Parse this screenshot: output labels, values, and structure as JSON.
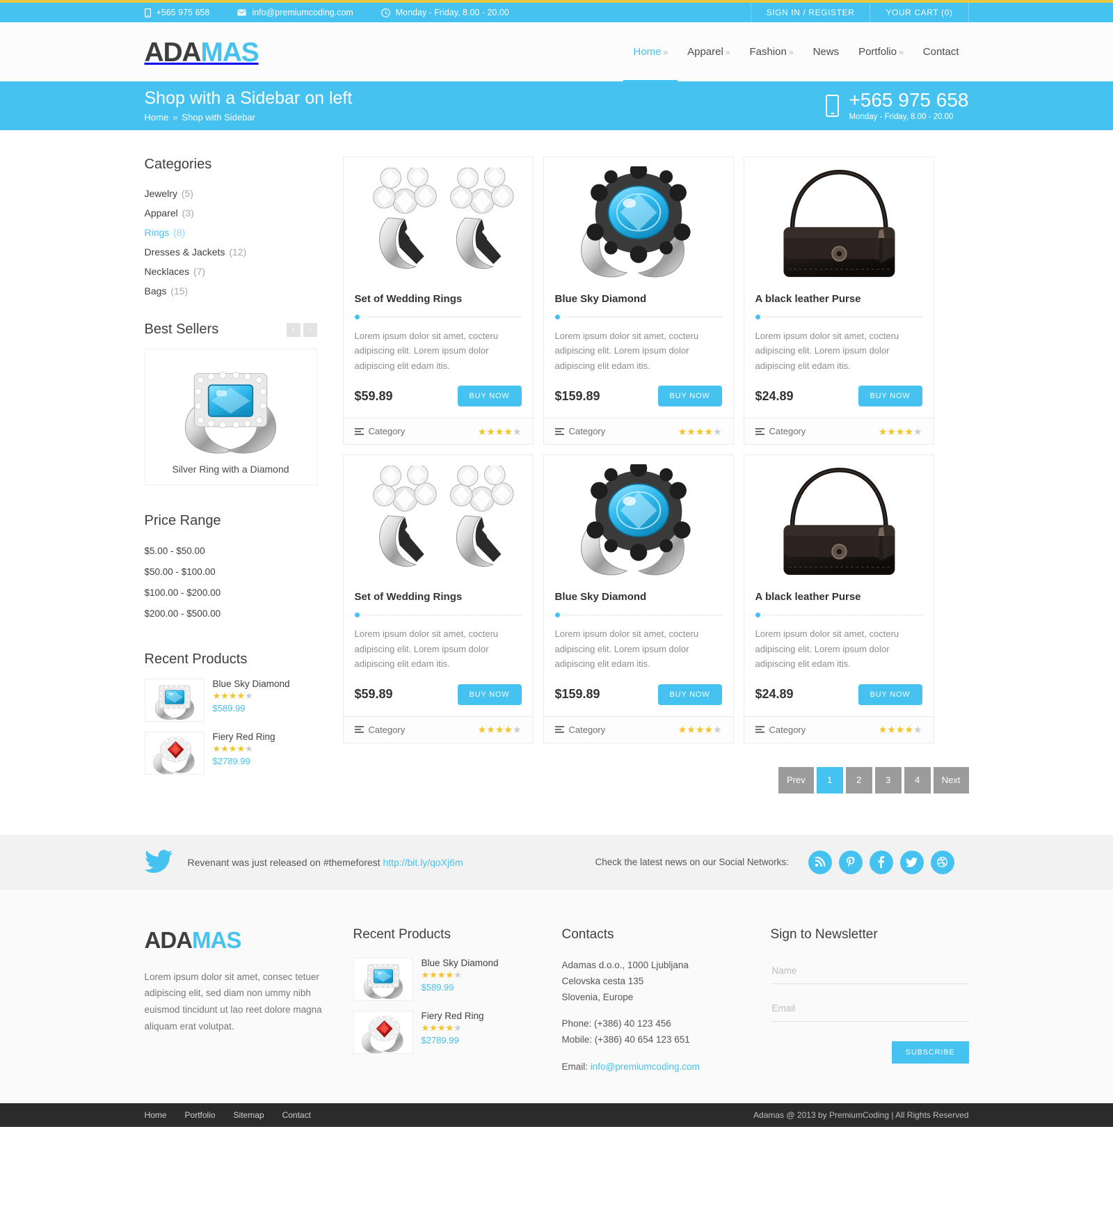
{
  "topbar": {
    "phone": "+565 975 658",
    "email": "info@premiumcoding.com",
    "hours": "Monday - Friday, 8.00 - 20.00",
    "signin": "SIGN IN / REGISTER",
    "cart": "YOUR CART (0)"
  },
  "header": {
    "logo_part1": "ADA",
    "logo_part2": "MAS",
    "nav": [
      {
        "label": "Home",
        "caret": "»",
        "active": true
      },
      {
        "label": "Apparel",
        "caret": "»",
        "active": false
      },
      {
        "label": "Fashion",
        "caret": "»",
        "active": false
      },
      {
        "label": "News",
        "caret": "",
        "active": false
      },
      {
        "label": "Portfolio",
        "caret": "»",
        "active": false
      },
      {
        "label": "Contact",
        "caret": "",
        "active": false
      }
    ]
  },
  "titlebar": {
    "title": "Shop with a Sidebar on left",
    "crumb_home": "Home",
    "crumb_sep": "»",
    "crumb_current": "Shop with Sidebar",
    "phone": "+565 975 658",
    "hours": "Monday - Friday, 8.00 - 20.00"
  },
  "sidebar": {
    "categories_heading": "Categories",
    "categories": [
      {
        "label": "Jewelry",
        "count": "(5)",
        "selected": false
      },
      {
        "label": "Apparel",
        "count": "(3)",
        "selected": false
      },
      {
        "label": "Rings",
        "count": "(8)",
        "selected": true
      },
      {
        "label": "Dresses & Jackets",
        "count": "(12)",
        "selected": false
      },
      {
        "label": "Necklaces",
        "count": "(7)",
        "selected": false
      },
      {
        "label": "Bags",
        "count": "(15)",
        "selected": false
      }
    ],
    "bestsellers_heading": "Best Sellers",
    "bestseller_prev": "‹",
    "bestseller_next": "›",
    "bestseller_caption": "Silver Ring with a Diamond",
    "pricerange_heading": "Price Range",
    "price_ranges": [
      "$5.00 - $50.00",
      "$50.00 - $100.00",
      "$100.00 - $200.00",
      "$200.00 - $500.00"
    ],
    "recent_heading": "Recent Products",
    "recent": [
      {
        "name": "Blue Sky Diamond",
        "rating": 4,
        "price": "$589.99"
      },
      {
        "name": "Fiery Red Ring",
        "rating": 4,
        "price": "$2789.99"
      }
    ]
  },
  "products": [
    {
      "title": "Set of Wedding Rings",
      "desc": "Lorem ipsum dolor sit amet, cocteru adipiscing elit. Lorem ipsum dolor adipiscing elit edam itis.",
      "price": "$59.89",
      "buy": "BUY NOW",
      "category": "Category",
      "rating": 4,
      "image": "wedding-rings"
    },
    {
      "title": "Blue Sky Diamond",
      "desc": "Lorem ipsum dolor sit amet, cocteru adipiscing elit. Lorem ipsum dolor adipiscing elit edam itis.",
      "price": "$159.89",
      "buy": "BUY NOW",
      "category": "Category",
      "rating": 4,
      "image": "blue-ring"
    },
    {
      "title": "A black leather Purse",
      "desc": "Lorem ipsum dolor sit amet, cocteru adipiscing elit. Lorem ipsum dolor adipiscing elit edam itis.",
      "price": "$24.89",
      "buy": "BUY NOW",
      "category": "Category",
      "rating": 4,
      "image": "purse"
    },
    {
      "title": "Set of Wedding Rings",
      "desc": "Lorem ipsum dolor sit amet, cocteru adipiscing elit. Lorem ipsum dolor adipiscing elit edam itis.",
      "price": "$59.89",
      "buy": "BUY NOW",
      "category": "Category",
      "rating": 4,
      "image": "wedding-rings"
    },
    {
      "title": "Blue Sky Diamond",
      "desc": "Lorem ipsum dolor sit amet, cocteru adipiscing elit. Lorem ipsum dolor adipiscing elit edam itis.",
      "price": "$159.89",
      "buy": "BUY NOW",
      "category": "Category",
      "rating": 4,
      "image": "blue-ring"
    },
    {
      "title": "A black leather Purse",
      "desc": "Lorem ipsum dolor sit amet, cocteru adipiscing elit. Lorem ipsum dolor adipiscing elit edam itis.",
      "price": "$24.89",
      "buy": "BUY NOW",
      "category": "Category",
      "rating": 4,
      "image": "purse"
    }
  ],
  "pagination": {
    "prev": "Prev",
    "pages": [
      "1",
      "2",
      "3",
      "4"
    ],
    "current": "1",
    "next": "Next"
  },
  "twitterbar": {
    "tweet_prefix": "Revenant was just released on #themeforest ",
    "tweet_link": "http://bit.ly/qoXj6m",
    "social_label": "Check the latest news on our Social Networks:",
    "social": [
      "rss-icon",
      "pinterest-icon",
      "facebook-icon",
      "twitter-icon",
      "dribbble-icon"
    ]
  },
  "footer": {
    "logo_part1": "ADA",
    "logo_part2": "MAS",
    "about": "Lorem ipsum dolor sit amet, consec tetuer adipiscing elit, sed diam non ummy nibh euismod tincidunt ut lao reet dolore magna aliquam erat volutpat.",
    "recent_heading": "Recent Products",
    "recent": [
      {
        "name": "Blue Sky Diamond",
        "rating": 4,
        "price": "$589.99"
      },
      {
        "name": "Fiery Red Ring",
        "rating": 4,
        "price": "$2789.99"
      }
    ],
    "contacts_heading": "Contacts",
    "address_line1": "Adamas d.o.o., 1000 Ljubljana",
    "address_line2": "Celovska cesta 135",
    "address_line3": "Slovenia, Europe",
    "phone_line": "Phone: (+386) 40 123 456",
    "mobile_line": "Mobile: (+386) 40 654 123 651",
    "email_label": "Email: ",
    "email_value": "info@premiumcoding.com",
    "newsletter_heading": "Sign to Newsletter",
    "name_placeholder": "Name",
    "email_placeholder": "Email",
    "subscribe": "SUBSCRIBE"
  },
  "bottombar": {
    "links": [
      "Home",
      "Portfolio",
      "Sitemap",
      "Contact"
    ],
    "copyright": "Adamas @ 2013 by PremiumCoding | All Rights Reserved"
  },
  "colors": {
    "accent": "#45c2f0",
    "gold": "#e8c63e",
    "star_on": "#f3c329",
    "star_off": "#cccccc",
    "pager": "#9b9b9b",
    "dark": "#2b2b2b"
  }
}
